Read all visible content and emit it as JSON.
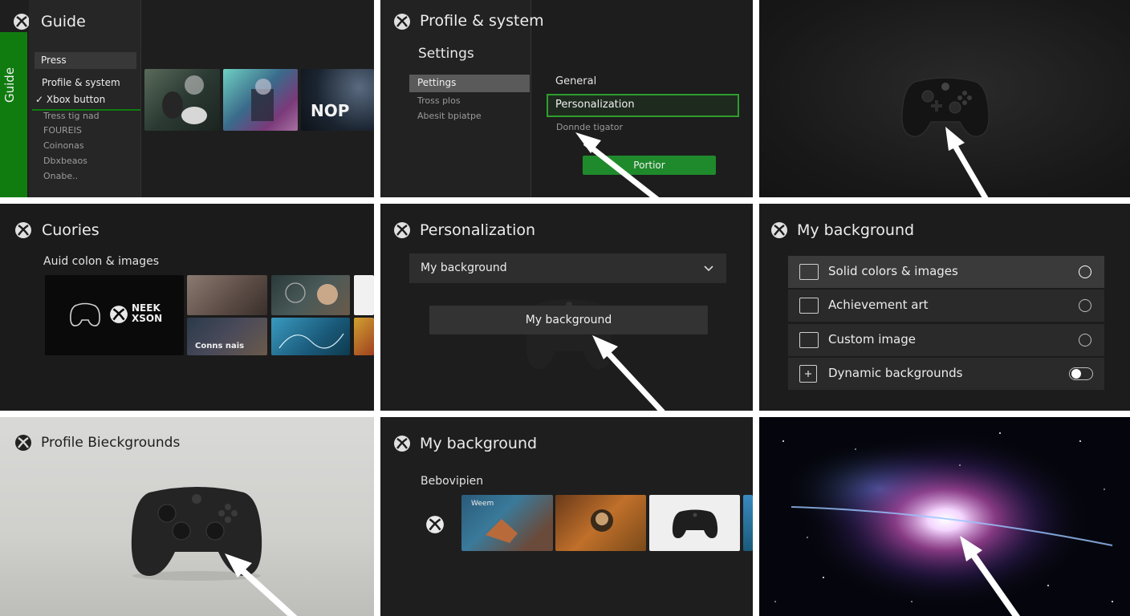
{
  "panels": {
    "guide": {
      "title": "Guide",
      "vertical_label": "Guide",
      "press_label": "Press",
      "items": [
        "Profile & system",
        "Xbox button",
        "Tress tig nad",
        "FOUREIS",
        "Coinonas",
        "Dbxbeaos",
        "Onabe.."
      ],
      "thumb_text": "NOP"
    },
    "profile_system": {
      "title": "Profile & system",
      "subtitle": "Settings",
      "side_items": [
        "Pettings",
        "Tross plos",
        "Abesit bpiatpe"
      ],
      "options": [
        "General",
        "Personalization",
        "Donnde tigator"
      ],
      "button_label": "Portior"
    },
    "controller": {},
    "colors_images": {
      "title": "Cuories",
      "subtitle": "Auid colon & images",
      "feature_text": "NEEK\nXSON",
      "tile_caption": "Conns nais"
    },
    "personalization": {
      "title": "Personalization",
      "dropdown_value": "My background",
      "button_label": "My background"
    },
    "my_background": {
      "title": "My background",
      "options": [
        {
          "label": "Solid colors & images",
          "control": "radio"
        },
        {
          "label": "Achievement art",
          "control": "radio"
        },
        {
          "label": "Custom image",
          "control": "radio"
        },
        {
          "label": "Dynamic backgrounds",
          "control": "toggle"
        }
      ]
    },
    "profile_backgrounds": {
      "title": "Profile Bieckgrounds"
    },
    "my_background_2": {
      "title": "My background",
      "subtitle": "Bebovipien",
      "tile_caption": "Weem"
    },
    "galaxy": {}
  },
  "colors": {
    "xbox_green": "#107c10",
    "button_green": "#1f8a2c",
    "focus_green": "#2e9e2e"
  }
}
